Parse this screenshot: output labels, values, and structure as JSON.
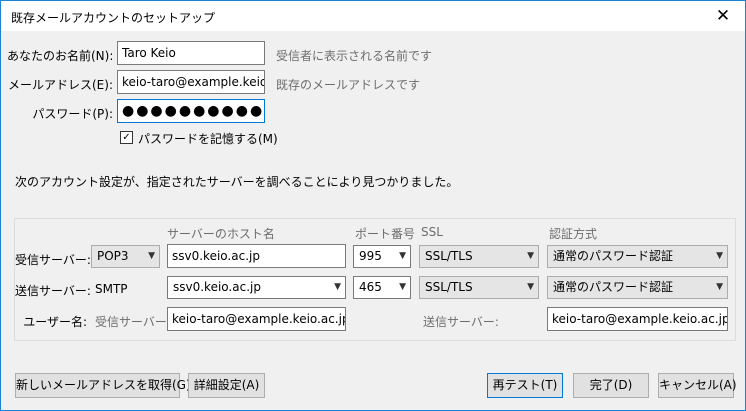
{
  "window": {
    "title": "既存メールアカウントのセットアップ"
  },
  "form": {
    "name_label": "あなたのお名前(N):",
    "name_value": "Taro Keio",
    "name_hint": "受信者に表示される名前です",
    "email_label": "メールアドレス(E):",
    "email_value": "keio-taro@example.keio.ac",
    "email_hint": "既存のメールアドレスです",
    "password_label": "パスワード(P):",
    "password_value": "●●●●●●●●●●",
    "remember_label": "パスワードを記憶する(M)",
    "remember_checked": "✓"
  },
  "status": "次のアカウント設定が、指定されたサーバーを調べることにより見つかりました。",
  "servers": {
    "headers": {
      "host": "サーバーのホスト名",
      "port": "ポート番号",
      "ssl": "SSL",
      "auth": "認証方式"
    },
    "incoming": {
      "label": "受信サーバー:",
      "protocol": "POP3",
      "host": "ssv0.keio.ac.jp",
      "port": "995",
      "ssl": "SSL/TLS",
      "auth": "通常のパスワード認証"
    },
    "outgoing": {
      "label": "送信サーバー:",
      "protocol": "SMTP",
      "host": "ssv0.keio.ac.jp",
      "port": "465",
      "ssl": "SSL/TLS",
      "auth": "通常のパスワード認証"
    },
    "username": {
      "label": "ユーザー名:",
      "incoming_label": "受信サーバー:",
      "incoming_value": "keio-taro@example.keio.ac.jp",
      "outgoing_label": "送信サーバー:",
      "outgoing_value": "keio-taro@example.keio.ac.jp"
    }
  },
  "buttons": {
    "new_address": "新しいメールアドレスを取得(G)...",
    "advanced": "詳細設定(A)",
    "retest": "再テスト(T)",
    "done": "完了(D)",
    "cancel": "キャンセル(A)"
  }
}
